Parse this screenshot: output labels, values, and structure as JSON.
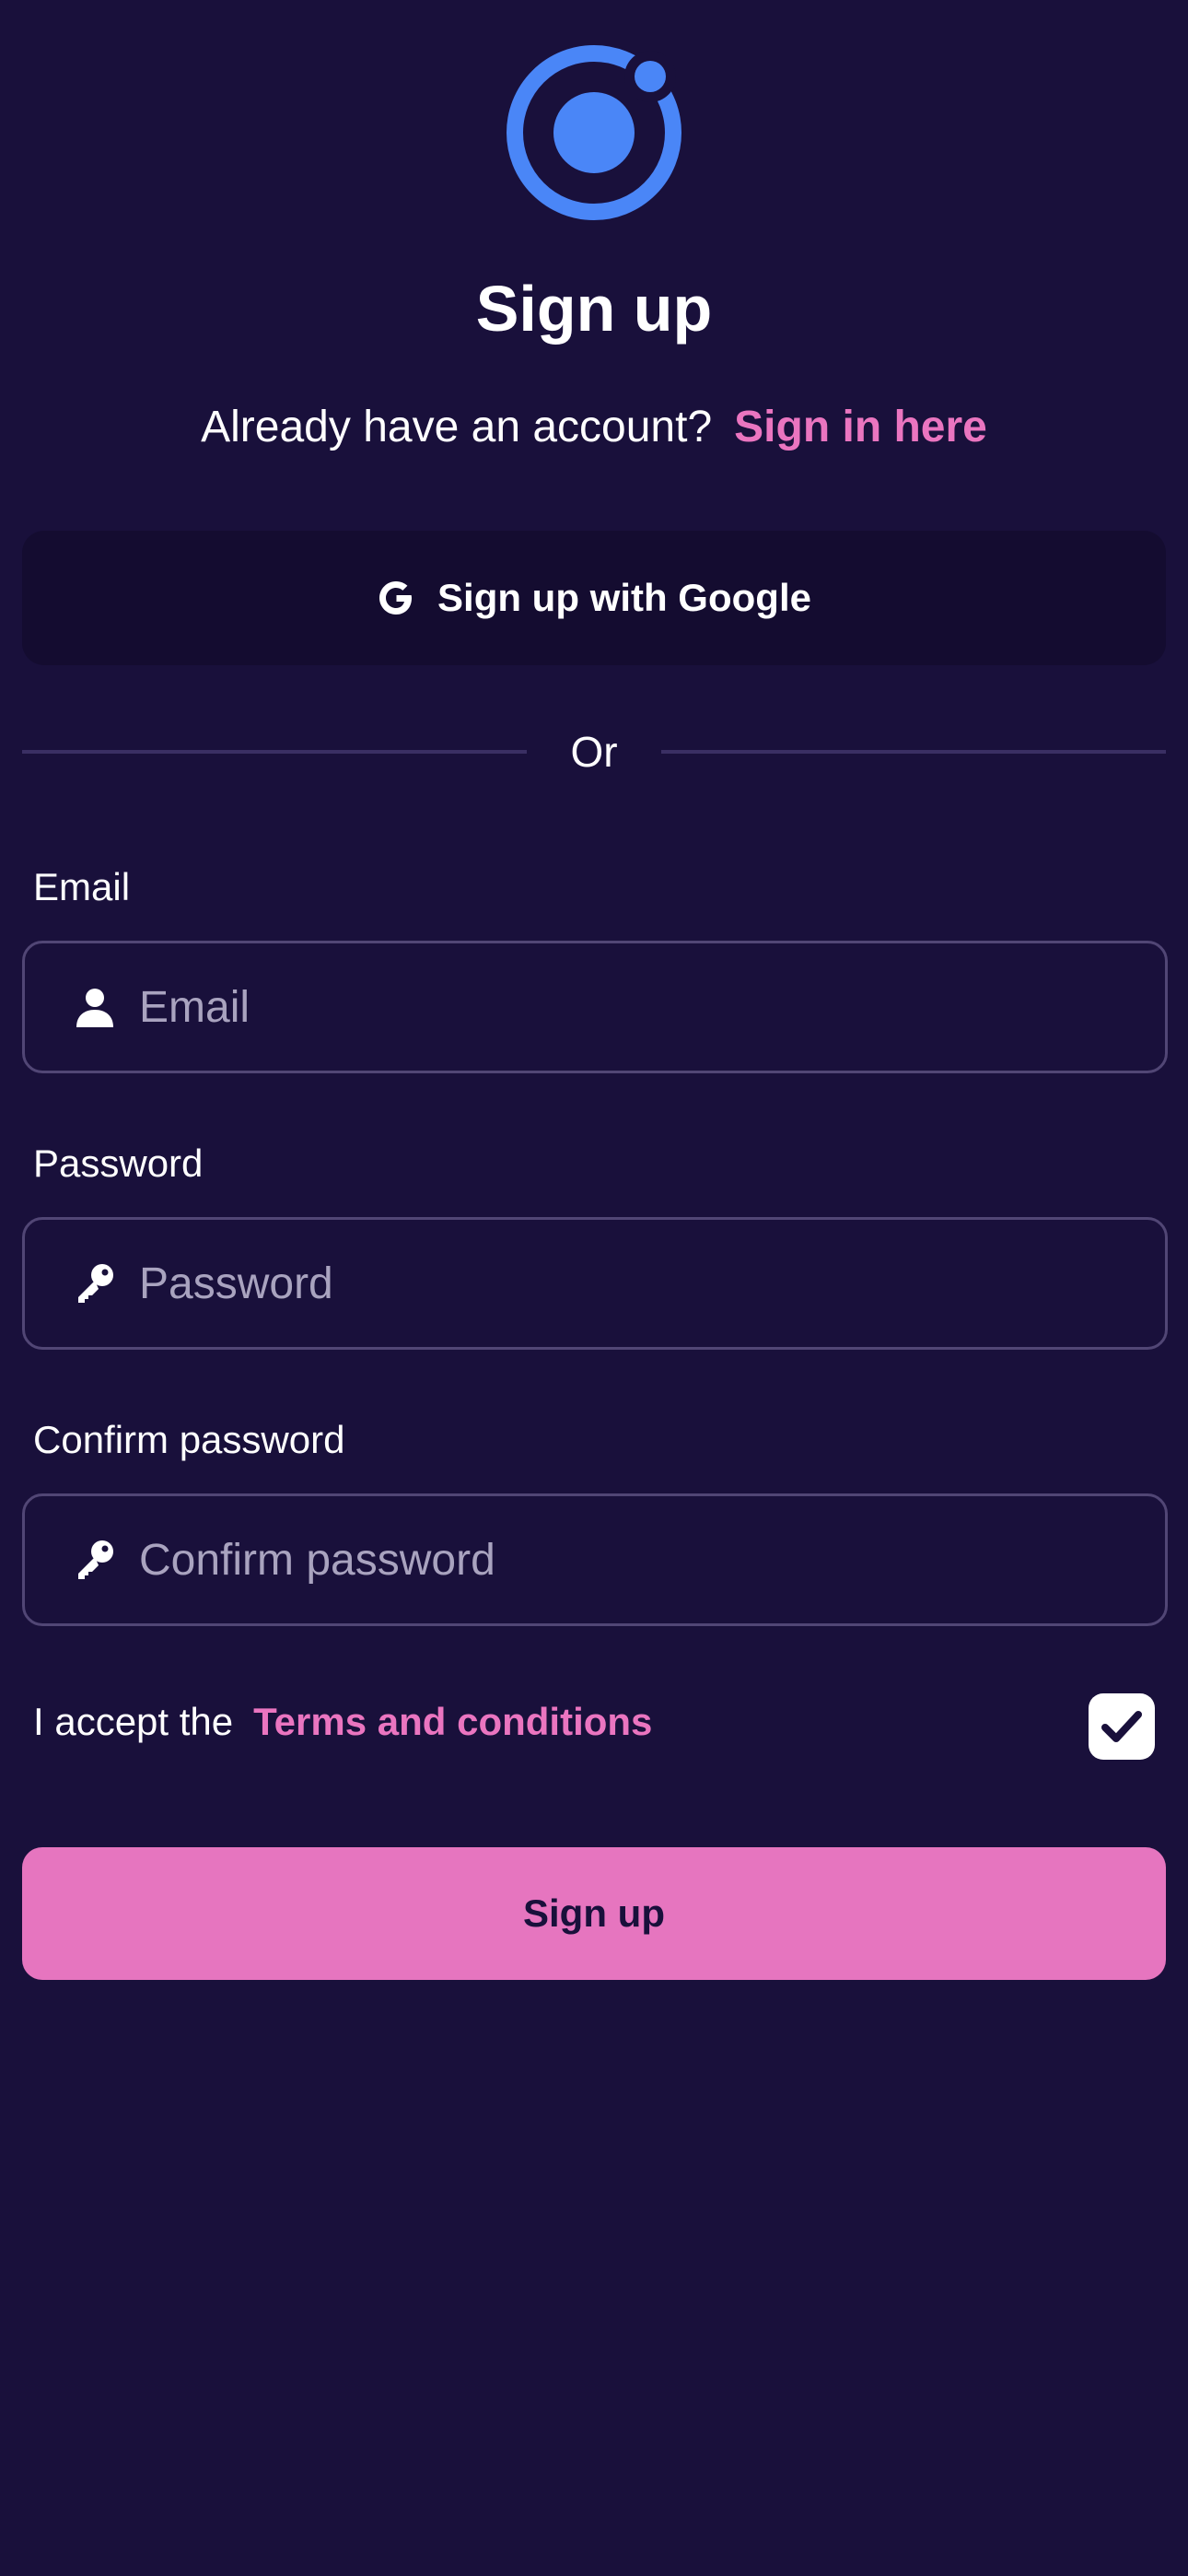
{
  "header": {
    "logo_icon": "ionic-logo-icon",
    "title": "Sign up"
  },
  "signin": {
    "question": "Already have an account?",
    "link_label": "Sign in here"
  },
  "google_button": {
    "icon": "google-icon",
    "label": "Sign up with Google"
  },
  "divider": {
    "label": "Or"
  },
  "form": {
    "email": {
      "label": "Email",
      "placeholder": "Email",
      "value": "",
      "icon": "person-icon"
    },
    "password": {
      "label": "Password",
      "placeholder": "Password",
      "value": "",
      "icon": "key-icon"
    },
    "confirm_password": {
      "label": "Confirm password",
      "placeholder": "Confirm password",
      "value": "",
      "icon": "key-icon"
    }
  },
  "terms": {
    "prefix": "I accept the",
    "link_label": "Terms and conditions",
    "checked": true
  },
  "submit": {
    "label": "Sign up"
  },
  "colors": {
    "background": "#19103b",
    "accent": "#e675bf",
    "link": "#ea75c0",
    "logo": "#4a86f7",
    "google_button_bg": "#140c30",
    "field_border": "#514675"
  }
}
